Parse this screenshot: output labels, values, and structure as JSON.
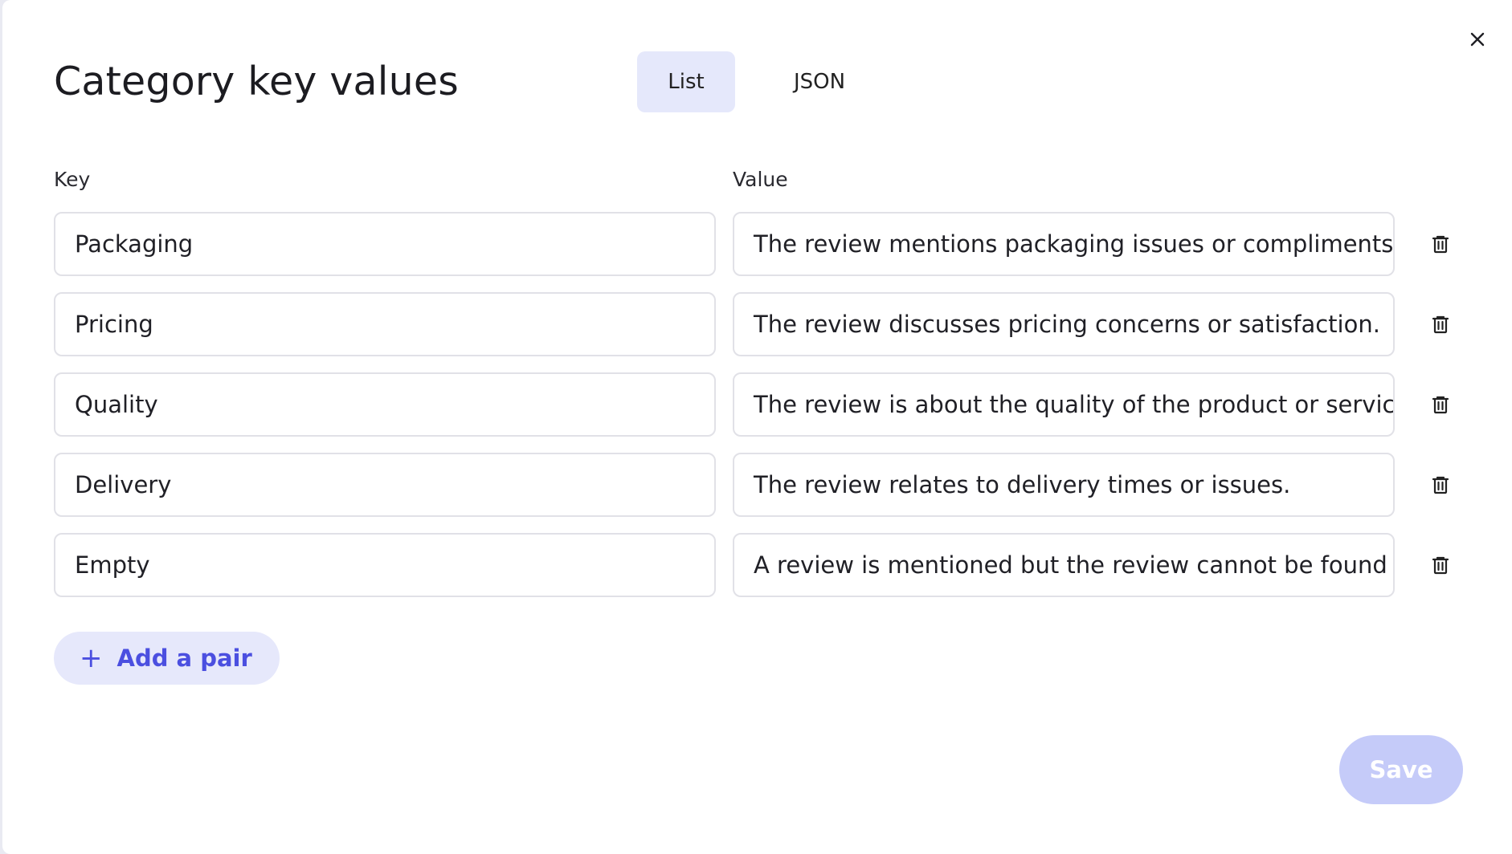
{
  "dialog": {
    "title": "Category key values",
    "close_icon": "close-icon"
  },
  "tabs": [
    {
      "label": "List",
      "active": true
    },
    {
      "label": "JSON",
      "active": false
    }
  ],
  "columns": {
    "key": "Key",
    "value": "Value"
  },
  "pairs": [
    {
      "key": "Packaging",
      "value": "The review mentions packaging issues or compliments."
    },
    {
      "key": "Pricing",
      "value": "The review discusses pricing concerns or satisfaction."
    },
    {
      "key": "Quality",
      "value": "The review is about the quality of the product or service."
    },
    {
      "key": "Delivery",
      "value": "The review relates to delivery times or issues."
    },
    {
      "key": "Empty",
      "value": "A review is mentioned but the review cannot be found"
    }
  ],
  "row_action_icon": "trash-icon",
  "add_button": {
    "icon": "+",
    "label": "Add a pair"
  },
  "save_button": {
    "label": "Save"
  },
  "colors": {
    "accent": "#4b4fe0",
    "accent_soft": "#e6e8fb",
    "save_disabled": "#c5cbf9"
  }
}
